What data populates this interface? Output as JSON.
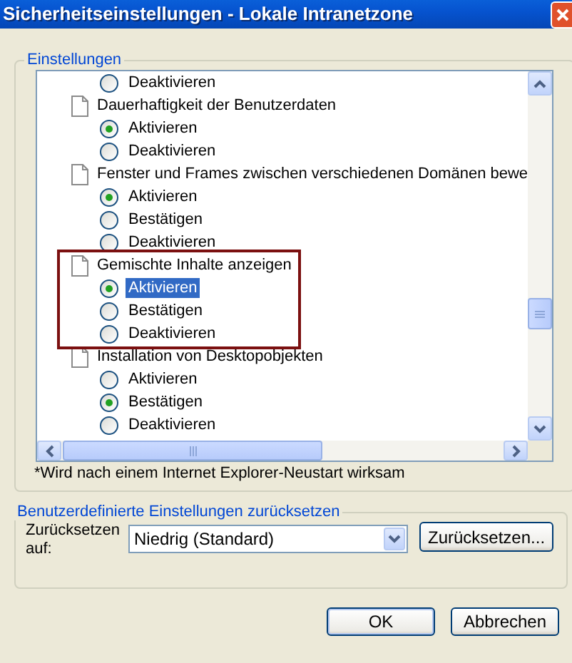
{
  "window": {
    "title": "Sicherheitseinstellungen - Lokale Intranetzone"
  },
  "settings_group": {
    "legend": "Einstellungen",
    "settings": [
      {
        "options": [
          {
            "label": "Deaktivieren",
            "selected": false,
            "highlighted": false
          }
        ]
      },
      {
        "label": "Dauerhaftigkeit der Benutzerdaten",
        "outlined": false,
        "options": [
          {
            "label": "Aktivieren",
            "selected": true,
            "highlighted": false
          },
          {
            "label": "Deaktivieren",
            "selected": false,
            "highlighted": false
          }
        ]
      },
      {
        "label": "Fenster und Frames zwischen verschiedenen Domänen bewe",
        "outlined": false,
        "options": [
          {
            "label": "Aktivieren",
            "selected": true,
            "highlighted": false
          },
          {
            "label": "Bestätigen",
            "selected": false,
            "highlighted": false
          },
          {
            "label": "Deaktivieren",
            "selected": false,
            "highlighted": false
          }
        ]
      },
      {
        "label": "Gemischte Inhalte anzeigen",
        "outlined": true,
        "options": [
          {
            "label": "Aktivieren",
            "selected": true,
            "highlighted": true
          },
          {
            "label": "Bestätigen",
            "selected": false,
            "highlighted": false
          },
          {
            "label": "Deaktivieren",
            "selected": false,
            "highlighted": false
          }
        ]
      },
      {
        "label": "Installation von Desktopobjekten",
        "outlined": false,
        "options": [
          {
            "label": "Aktivieren",
            "selected": false,
            "highlighted": false
          },
          {
            "label": "Bestätigen",
            "selected": true,
            "highlighted": false
          },
          {
            "label": "Deaktivieren",
            "selected": false,
            "highlighted": false
          }
        ]
      }
    ],
    "footnote": "*Wird nach einem Internet Explorer-Neustart wirksam"
  },
  "reset_group": {
    "legend": "Benutzerdefinierte Einstellungen zurücksetzen",
    "label": "Zurücksetzen auf:",
    "dropdown": {
      "value": "Niedrig (Standard)"
    },
    "button": "Zurücksetzen..."
  },
  "buttons": [
    "OK",
    "Abbrechen"
  ]
}
